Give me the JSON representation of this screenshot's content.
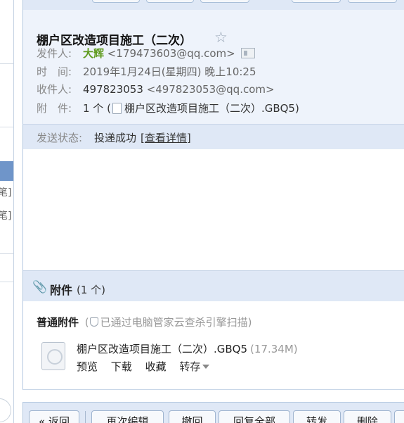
{
  "sidebar": {
    "fragment_1": "笔]",
    "fragment_2": "笔]"
  },
  "email": {
    "subject": "棚户区改造项目施工（二次）",
    "from_label": "发件人:",
    "from_name": "大辉",
    "from_address": "<179473603@qq.com>",
    "time_label": "时　间:",
    "time_value": "2019年1月24日(星期四) 晚上10:25",
    "to_label": "收件人:",
    "to_name": "497823053",
    "to_address": "<497823053@qq.com>",
    "attach_label": "附　件:",
    "attach_prefix": "1 个 (",
    "attach_name": "棚户区改造项目施工（二次）.GBQ5)"
  },
  "status": {
    "label": "发送状态:",
    "value": "投递成功",
    "detail_link": "[查看详情]"
  },
  "attachments": {
    "title": "附件",
    "count": "(1 个)",
    "kind_title": "普通附件",
    "scan_open": "(",
    "scan_text": "已通过电脑管家云查杀引擎扫描)",
    "file": {
      "name": "棚户区改造项目施工（二次）.GBQ5",
      "size": "(17.34M)"
    },
    "actions": {
      "preview": "预览",
      "download": "下载",
      "favorite": "收藏",
      "save_to": "转存"
    }
  },
  "toolbar": {
    "back": "« 返回",
    "re_edit": "再次编辑",
    "recall": "撤回",
    "reply_all": "回复全部",
    "forward": "转发",
    "delete": "删除"
  }
}
